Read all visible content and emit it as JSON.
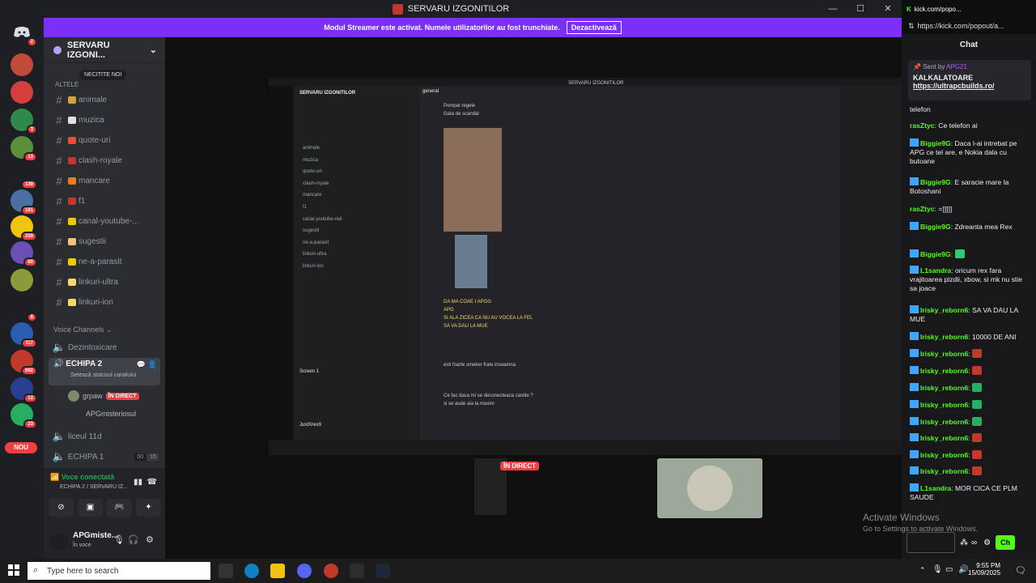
{
  "window": {
    "title": "SERVARU IZGONITILOR"
  },
  "banner": {
    "text": "Modul Streamer este activat. Numele utilizatorilor au fost trunchiate.",
    "button": "Dezactivează"
  },
  "servers": {
    "badges": [
      "2",
      "3",
      "13",
      "139",
      "181",
      "259",
      "80",
      "8",
      "117",
      "692",
      "12",
      "23"
    ],
    "nou": "NOU"
  },
  "sidebar": {
    "server_name": "SERVARU IZGONI...",
    "unread_pill": "NECITITE NOI",
    "category": "ALTELE",
    "channels": [
      "animale",
      "muzica",
      "quote-uri",
      "clash-royale",
      "mancare",
      "f1",
      "canal-youtube-...",
      "sugestii",
      "ne-a-parasit",
      "linkuri-ultra",
      "linkuri-ion"
    ],
    "voice_header": "Voice Channels",
    "voice_channels": [
      {
        "name": "Dezintoxicare"
      },
      {
        "name": "ECHIPA 2",
        "status": "Setează statusul canalului"
      }
    ],
    "voice_users": [
      {
        "name": "grpaw",
        "badge": "ÎN DIRECT"
      },
      {
        "name": "APGmisteriosul"
      }
    ],
    "more_voice": [
      {
        "name": "liceul 11d"
      },
      {
        "name": "ECHIPA 1",
        "count_a": "00",
        "count_b": "15"
      }
    ]
  },
  "voice_panel": {
    "status": "Voce conectată",
    "location": "ECHIPA 2 / SERVARU IZ..."
  },
  "user": {
    "name": "APGmiste...",
    "status": "În voce"
  },
  "stream": {
    "live_badge": "ÎN DIRECT",
    "inner_title": "SERVARU IZGONITILOR",
    "inner_channel": "general",
    "inner_lines": [
      "Pompat regele",
      "Gata de scandal",
      "DA MA COAE I APGG",
      "APG",
      "SI ALA ZICEA CA NU AU VOCEA LA FEL",
      "SA VA DAU LA MUE",
      "esti foarte smeker frate inseamna",
      "Ce fac daca mi se deconecteaza castile ?",
      "si se aude aia la maxim"
    ],
    "inner_sidebar": [
      "animale",
      "muzica",
      "quote-uri",
      "clash-royale",
      "mancare",
      "f1",
      "canal-youtube-red",
      "sugestii",
      "ne-a-parasit",
      "linkuri-ultra",
      "linkuri-ion"
    ],
    "inner_user": "JustXrexX",
    "screen_label": "Screen 1"
  },
  "popout": {
    "tab": "kick.com/popo...",
    "url": "https://kick.com/popout/a...",
    "title": "Chat",
    "pinned": {
      "sent_by": "Sent by",
      "sender": "APG21",
      "title": "KALKALATOARE",
      "link": "https://ultrapcbuilds.ro/"
    },
    "messages": [
      {
        "user": "",
        "text": "telefon"
      },
      {
        "user": "rasZtyc",
        "text": "Ce telefon ai"
      },
      {
        "user": "Biggie9G",
        "text": "Daca l-ai intrebat pe APG ce tel are, e Nokia dala cu butoane"
      },
      {
        "user": "Biggie9G",
        "text": "E saracie mare la Botoshani"
      },
      {
        "user": "rasZtyc",
        "text": "=]]]]]"
      },
      {
        "user": "Biggie9G",
        "text": "Zdreanta mea Rex"
      },
      {
        "user": "Biggie9G",
        "text": ""
      },
      {
        "user": "L1sandra",
        "text": "oricum rex fara vrajitoarea pizdii, xbow, si mk nu stie sa joace"
      },
      {
        "user": "Irisky_reborn6",
        "text": "SA VA DAU LA MUE"
      },
      {
        "user": "Irisky_reborn6",
        "text": "10000 DE ANI"
      },
      {
        "user": "Irisky_reborn6",
        "text": ""
      },
      {
        "user": "Irisky_reborn6",
        "text": ""
      },
      {
        "user": "Irisky_reborn6",
        "text": ""
      },
      {
        "user": "Irisky_reborn6",
        "text": ""
      },
      {
        "user": "Irisky_reborn6",
        "text": ""
      },
      {
        "user": "Irisky_reborn6",
        "text": ""
      },
      {
        "user": "Irisky_reborn6",
        "text": ""
      },
      {
        "user": "Irisky_reborn6",
        "text": ""
      },
      {
        "user": "L1sandra",
        "text": "MOR CICA CE PLM SAUDE"
      }
    ],
    "send_partial": "Ch"
  },
  "watermark": {
    "line1": "Activate Windows",
    "line2": "Go to Settings to activate Windows."
  },
  "taskbar": {
    "search": "Type here to search",
    "time": "9:55 PM",
    "date": "15/09/2025"
  },
  "colors": {
    "banner": "#7b2ff7",
    "live": "#ed4245",
    "kick_green": "#53fc18",
    "user_green": "#53fc18",
    "user_blue": "#3ea6ff"
  }
}
